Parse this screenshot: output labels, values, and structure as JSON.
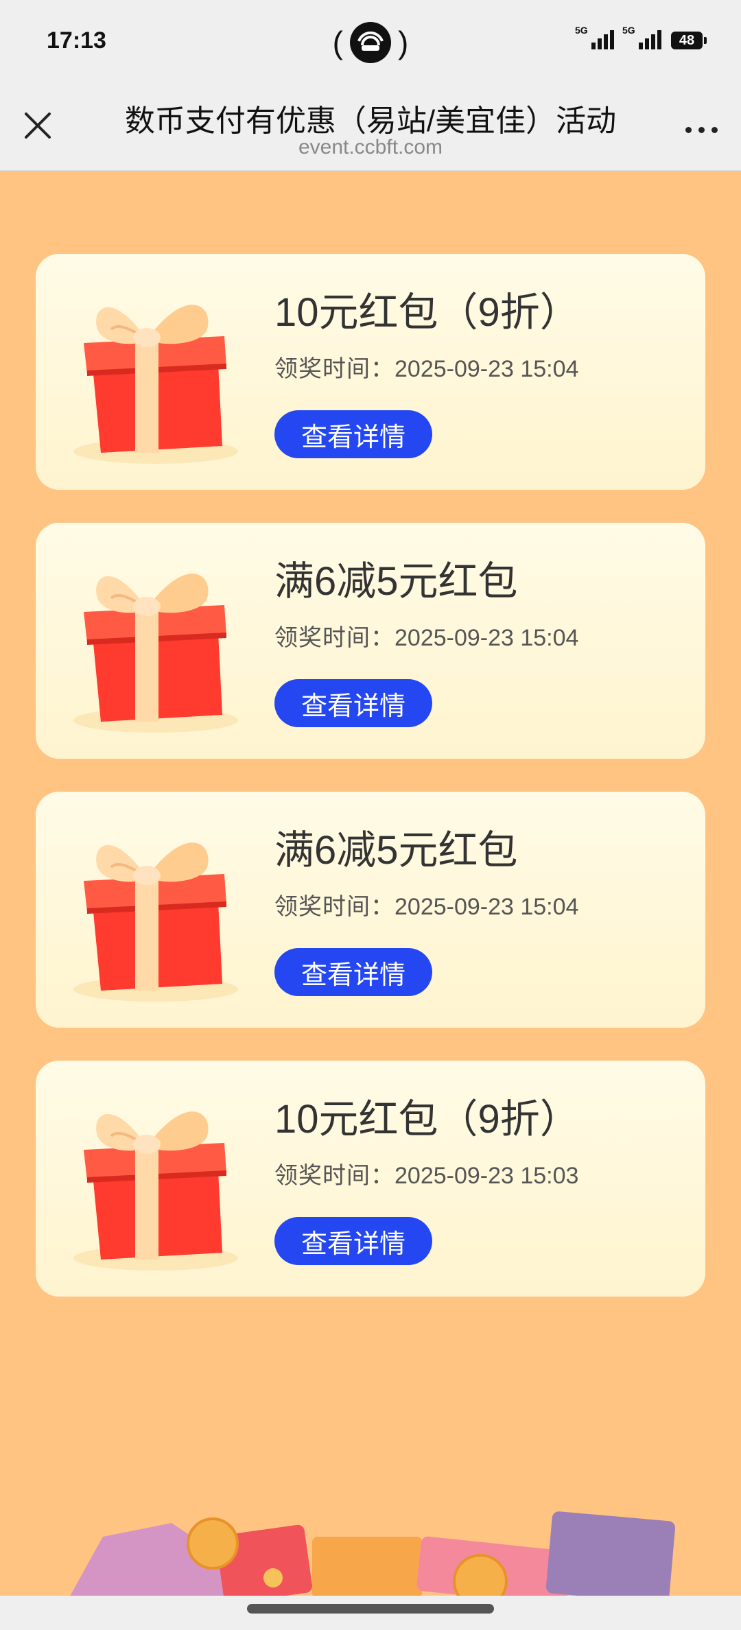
{
  "status": {
    "time": "17:13",
    "battery": "48",
    "sim1": "5G",
    "sim2": "5G"
  },
  "nav": {
    "title": "数币支付有优惠（易站/美宜佳）活动",
    "subtitle": "event.ccbft.com"
  },
  "cards": [
    {
      "title": "10元红包（9折）",
      "time_label": "领奖时间：",
      "time": "2025-09-23 15:04",
      "button": "查看详情"
    },
    {
      "title": "满6减5元红包",
      "time_label": "领奖时间：",
      "time": "2025-09-23 15:04",
      "button": "查看详情"
    },
    {
      "title": "满6减5元红包",
      "time_label": "领奖时间：",
      "time": "2025-09-23 15:04",
      "button": "查看详情"
    },
    {
      "title": "10元红包（9折）",
      "time_label": "领奖时间：",
      "time": "2025-09-23 15:03",
      "button": "查看详情"
    }
  ],
  "colors": {
    "background": "#ffc382",
    "button": "#2447f2",
    "gift_red": "#ff3a2e",
    "ribbon": "#ffd9a8"
  },
  "icons": [
    "close-icon",
    "more-icon",
    "hotspot-icon",
    "gift-icon",
    "battery-icon",
    "signal-icon"
  ]
}
